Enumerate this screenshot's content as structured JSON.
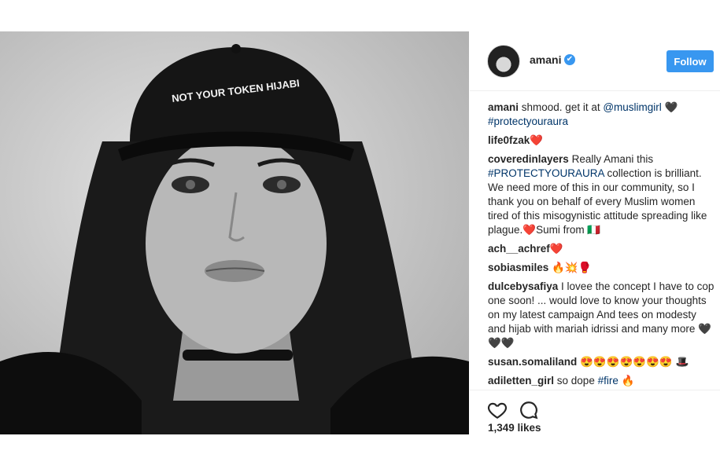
{
  "post": {
    "hat_text": "NOT YOUR TOKEN HIJABI"
  },
  "header": {
    "username": "amani",
    "verified_mark": "✔",
    "follow_label": "Follow"
  },
  "comments": [
    {
      "user": "amani",
      "parts": [
        {
          "t": "text",
          "v": " shmood. get it at "
        },
        {
          "t": "link",
          "v": "@muslimgirl"
        },
        {
          "t": "text",
          "v": " 🖤 "
        },
        {
          "t": "link",
          "v": "#protectyouraura"
        }
      ]
    },
    {
      "user": "life0fzak",
      "parts": [
        {
          "t": "text",
          "v": "❤️"
        }
      ]
    },
    {
      "user": "coveredinlayers",
      "parts": [
        {
          "t": "text",
          "v": " Really Amani this "
        },
        {
          "t": "link",
          "v": "#PROTECTYOURAURA"
        },
        {
          "t": "text",
          "v": " collection is brilliant. We need more of this in our community, so I thank you on behalf of every Muslim women tired of this misogynistic attitude spreading like plague.❤️Sumi from 🇮🇹"
        }
      ]
    },
    {
      "user": "ach__achref",
      "parts": [
        {
          "t": "text",
          "v": "❤️"
        }
      ]
    },
    {
      "user": "sobiasmiles",
      "parts": [
        {
          "t": "text",
          "v": " 🔥💥🥊"
        }
      ]
    },
    {
      "user": "dulcebysafiya",
      "parts": [
        {
          "t": "text",
          "v": " I lovee the concept I have to cop one soon! ... would love to know your thoughts on my latest campaign And tees on modesty and hijab with mariah idrissi and many more 🖤🖤🖤"
        }
      ]
    },
    {
      "user": "susan.somaliland",
      "parts": [
        {
          "t": "text",
          "v": " 😍😍😍😍😍😍😍 🎩"
        }
      ]
    },
    {
      "user": "adiletten_girl",
      "parts": [
        {
          "t": "text",
          "v": " so dope "
        },
        {
          "t": "link",
          "v": "#fire"
        },
        {
          "t": "text",
          "v": " 🔥"
        }
      ]
    }
  ],
  "actions": {
    "like_icon": "heart-icon",
    "comment_icon": "comment-bubble-icon",
    "likes_text": "1,349 likes"
  },
  "colors": {
    "accent": "#3897f0",
    "link": "#003569",
    "text": "#262626"
  }
}
